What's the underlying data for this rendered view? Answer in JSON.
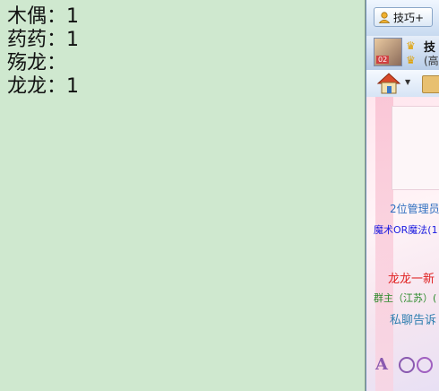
{
  "editor": {
    "lines": [
      "木偶：1",
      "药药：1",
      "殇龙：",
      "龙龙：1"
    ]
  },
  "panel": {
    "tip_button": "技巧+",
    "group_name": "技",
    "group_sub": "(高",
    "avatar_level": "02",
    "messages": {
      "m1": "2位管理员",
      "m2": "魔术OR魔法(1",
      "m3": "龙龙一新",
      "m4": "群主（江苏）(",
      "m5": "私聊告诉"
    }
  }
}
